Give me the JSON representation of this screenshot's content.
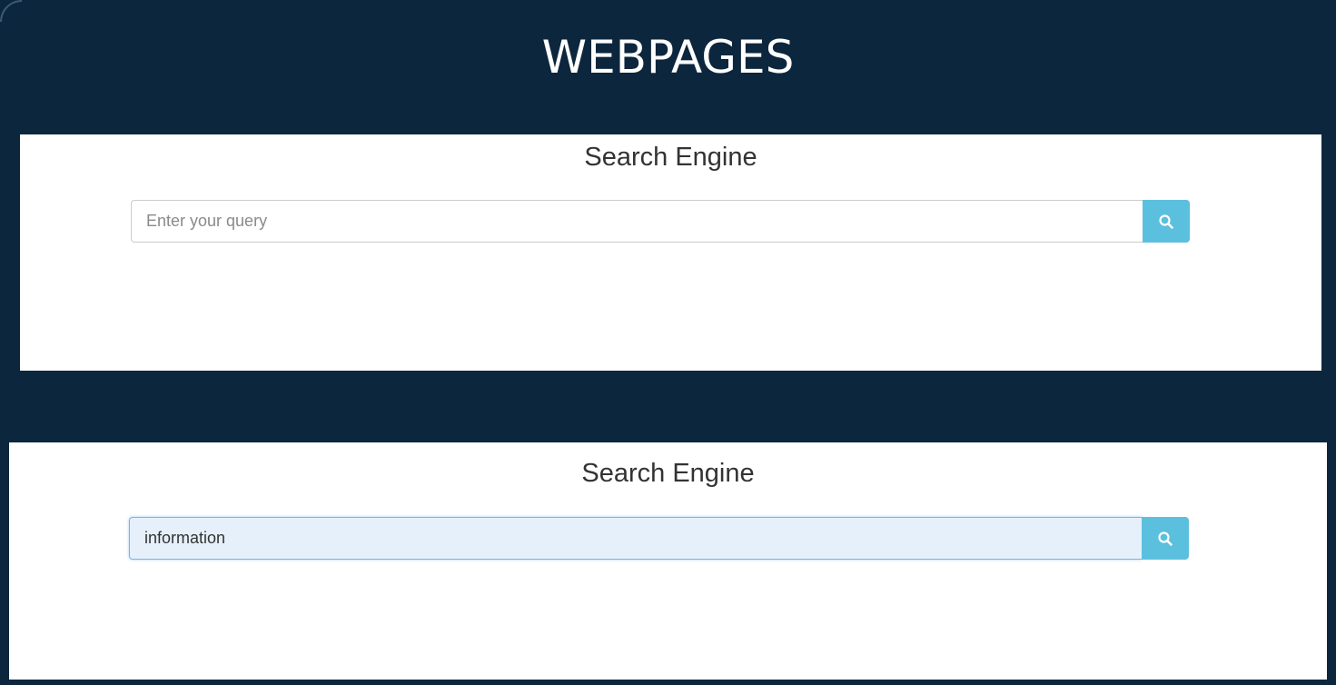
{
  "slide": {
    "title": "WEBPAGES"
  },
  "panels": [
    {
      "heading": "Search Engine",
      "search": {
        "placeholder": "Enter your query",
        "value": "",
        "button_icon": "search-icon"
      }
    },
    {
      "heading": "Search Engine",
      "search": {
        "placeholder": "",
        "value": "information",
        "button_icon": "search-icon"
      }
    }
  ],
  "colors": {
    "background": "#0c263d",
    "button": "#5bc0de",
    "filled_input": "#e6f0fb"
  }
}
